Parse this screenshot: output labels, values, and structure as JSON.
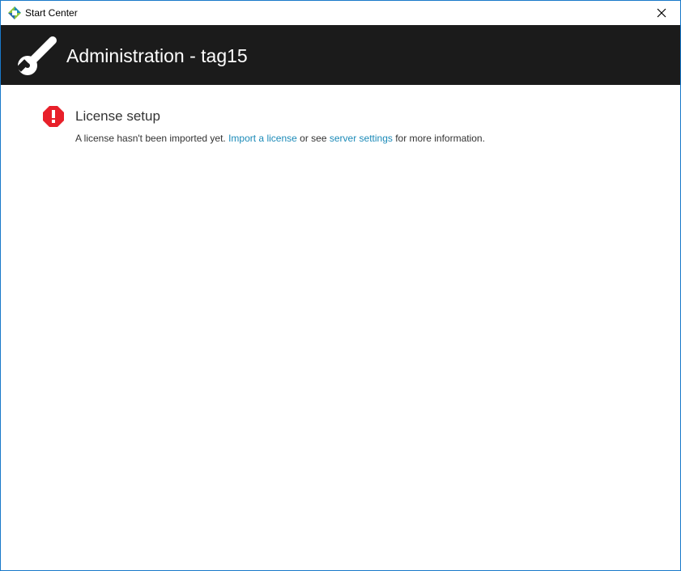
{
  "window": {
    "title": "Start Center",
    "app_icon": "start-center-logo-icon",
    "close_icon": "close-icon"
  },
  "header": {
    "title": "Administration - tag15",
    "icon": "wrench-icon",
    "background": "#1b1b1b"
  },
  "notice": {
    "icon": "error-octagon-icon",
    "icon_color": "#e8202a",
    "title": "License setup",
    "text_before": "A license hasn't been imported yet.",
    "import_link": "Import a license",
    "text_middle": "or see",
    "settings_link": "server settings",
    "text_after": "for more information.",
    "link_color": "#1b8ab8"
  }
}
